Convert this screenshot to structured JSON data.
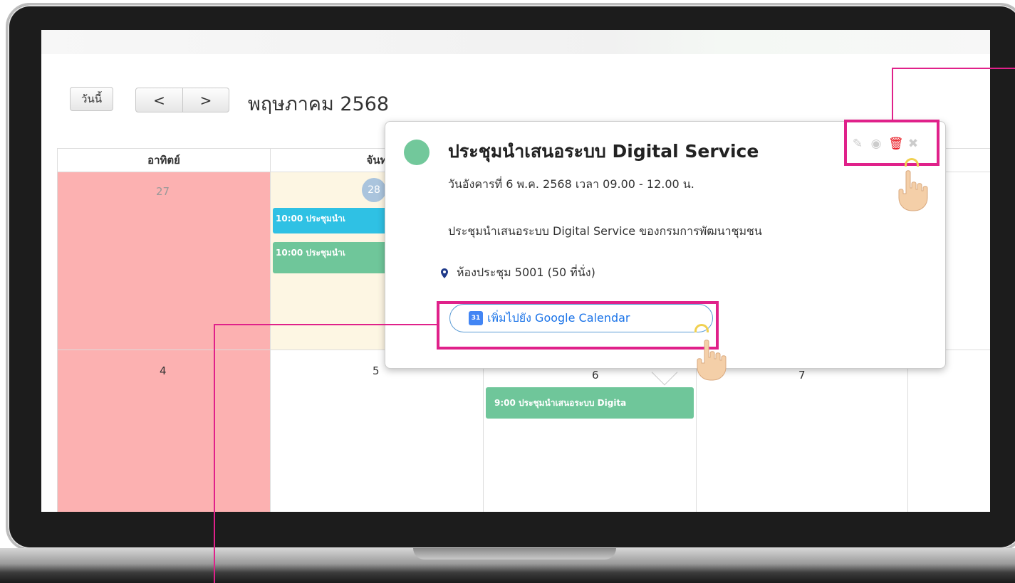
{
  "toolbar": {
    "today_label": "วันนี้",
    "prev_label": "<",
    "next_label": ">",
    "month_title": "พฤษภาคม 2568"
  },
  "weekdays": [
    "อาทิตย์",
    "จันท"
  ],
  "week1_days": {
    "sun": "27",
    "mon": "28"
  },
  "week2_days": {
    "sun": "4",
    "mon": "5",
    "tue": "6",
    "wed": "7"
  },
  "events": {
    "mon_blue": "10:00 ประชุมนำเ",
    "mon_green": "10:00 ประชุมนำเ",
    "tue_green": "9:00 ประชุมนำเสนอระบบ Digita"
  },
  "popover": {
    "title": "ประชุมนำเสนอระบบ Digital Service",
    "date_time": "วันอังคารที่ 6 พ.ค. 2568 เวลา 09.00 - 12.00 น.",
    "description": "ประชุมนำเสนอระบบ Digital Service ของกรมการพัฒนาชุมชน",
    "location": "ห้องประชุม 5001 (50 ที่นั่ง)",
    "gcal_label": "เพิ่มไปยัง Google Calendar",
    "gcal_icon_text": "31",
    "event_color": "#72c89b",
    "tools": [
      "edit-icon",
      "view-icon",
      "delete-icon",
      "close-icon"
    ]
  },
  "colors": {
    "sunday_bg": "#fcb1b1",
    "today_bg": "#fdf6e3",
    "highlight": "#e0218a",
    "event_blue": "#2fc1e4",
    "event_green": "#6fc69a"
  }
}
